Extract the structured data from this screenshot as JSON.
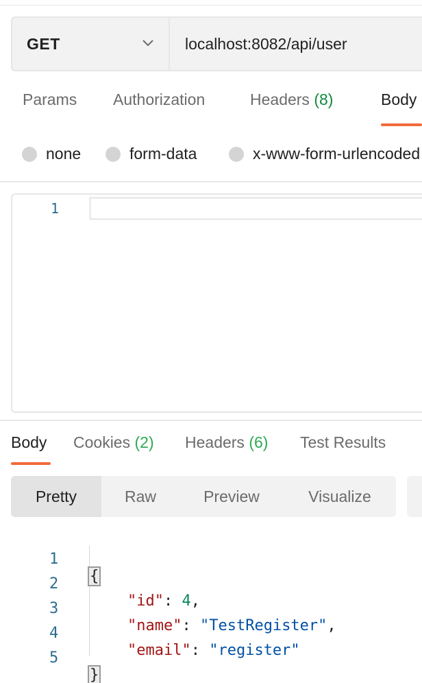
{
  "request": {
    "method": "GET",
    "url": "localhost:8082/api/user"
  },
  "request_tabs": [
    {
      "label": "Params"
    },
    {
      "label": "Authorization"
    },
    {
      "label": "Headers",
      "count": "(8)"
    },
    {
      "label": "Body"
    }
  ],
  "body_types": [
    "none",
    "form-data",
    "x-www-form-urlencoded"
  ],
  "request_editor": {
    "line_numbers": [
      "1"
    ]
  },
  "response_tabs": [
    {
      "label": "Body"
    },
    {
      "label": "Cookies",
      "count": "(2)"
    },
    {
      "label": "Headers",
      "count": "(6)"
    },
    {
      "label": "Test Results"
    }
  ],
  "view_modes": [
    "Pretty",
    "Raw",
    "Preview",
    "Visualize"
  ],
  "response_body": {
    "line_numbers": [
      "1",
      "2",
      "3",
      "4",
      "5"
    ],
    "open_brace": "{",
    "close_brace": "}",
    "fields": [
      {
        "key": "\"id\"",
        "value": "4",
        "type": "number",
        "trailing": ","
      },
      {
        "key": "\"name\"",
        "value": "\"TestRegister\"",
        "type": "string",
        "trailing": ","
      },
      {
        "key": "\"email\"",
        "value": "\"register\"",
        "type": "string",
        "trailing": ""
      }
    ]
  },
  "colors": {
    "accent": "#f26b3a",
    "count_green": "#0f8a3c",
    "json_key": "#a31515",
    "json_string": "#0451a5",
    "json_number": "#098658"
  }
}
